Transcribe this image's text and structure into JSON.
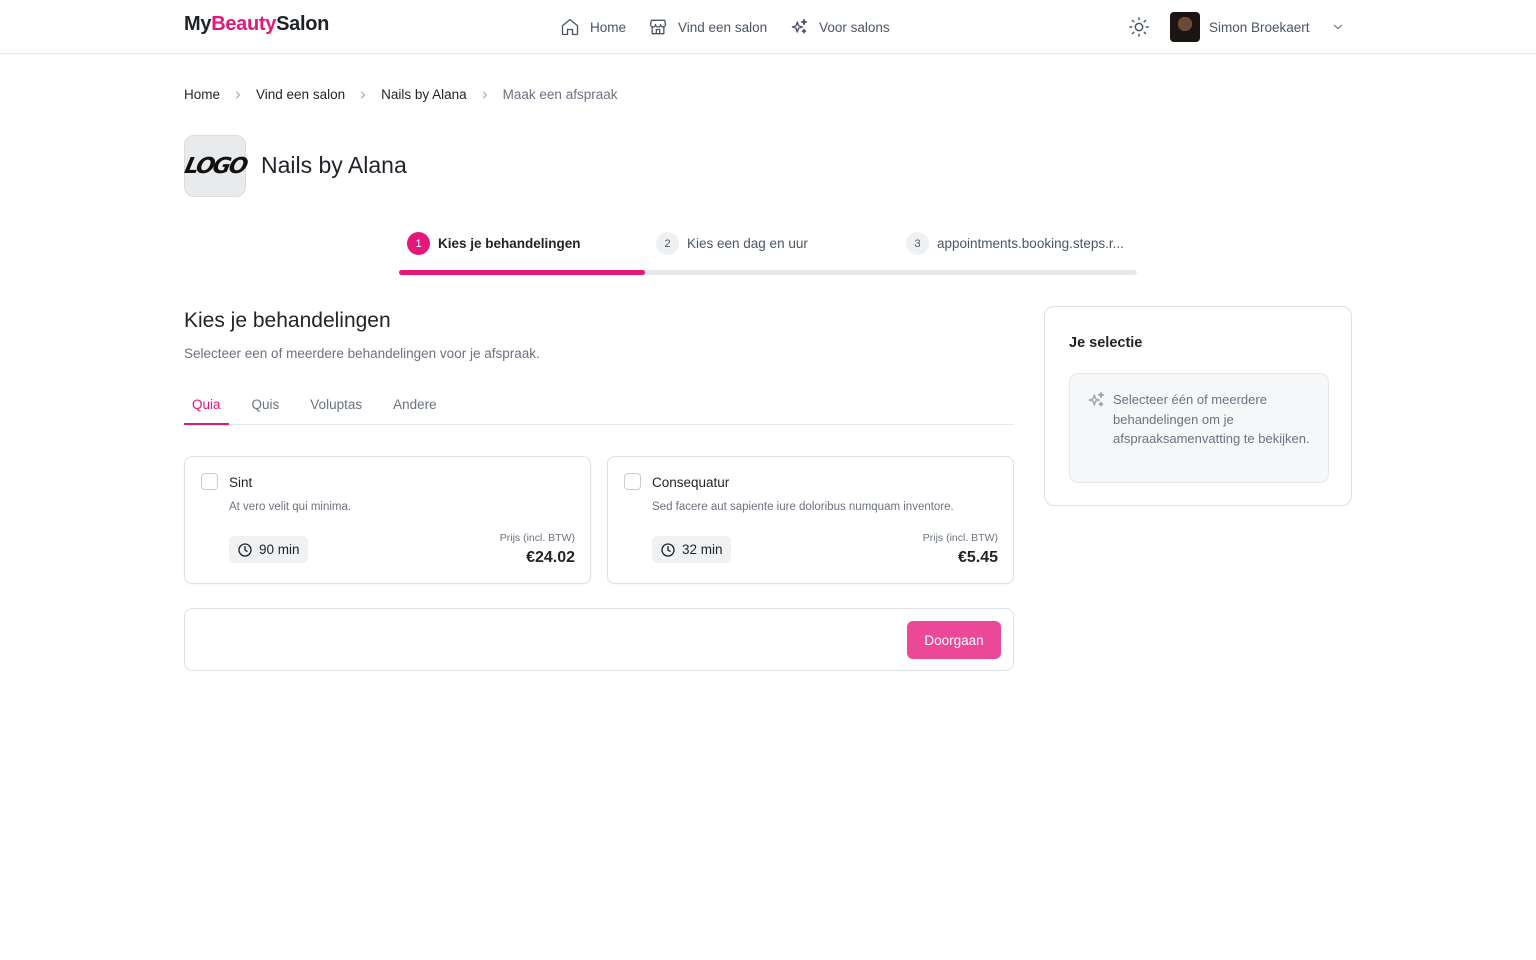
{
  "brand": {
    "prefix": "My",
    "accent": "Beauty",
    "suffix": "Salon"
  },
  "nav": [
    {
      "label": "Home",
      "icon": "home-icon"
    },
    {
      "label": "Vind een salon",
      "icon": "store-icon"
    },
    {
      "label": "Voor salons",
      "icon": "sparkles-icon"
    }
  ],
  "user": {
    "name": "Simon Broekaert"
  },
  "breadcrumb": [
    "Home",
    "Vind een salon",
    "Nails by Alana",
    "Maak een afspraak"
  ],
  "salon": {
    "logo_text": "LOGO",
    "name": "Nails by Alana"
  },
  "steps": {
    "items": [
      {
        "num": "1",
        "label": "Kies je behandelingen"
      },
      {
        "num": "2",
        "label": "Kies een dag en uur"
      },
      {
        "num": "3",
        "label": "appointments.booking.steps.r..."
      }
    ],
    "current": 1,
    "progress": 0.333
  },
  "section": {
    "title": "Kies je behandelingen",
    "subtitle": "Selecteer een of meerdere behandelingen voor je afspraak."
  },
  "tabs": [
    "Quia",
    "Quis",
    "Voluptas",
    "Andere"
  ],
  "treatments": [
    {
      "name": "Sint",
      "description": "At vero velit qui minima.",
      "duration": "90 min",
      "price_label": "Prijs (incl. BTW)",
      "price": "€24.02"
    },
    {
      "name": "Consequatur",
      "description": "Sed facere aut sapiente iure doloribus numquam inventore.",
      "duration": "32 min",
      "price_label": "Prijs (incl. BTW)",
      "price": "€5.45"
    }
  ],
  "actions": {
    "continue": "Doorgaan"
  },
  "selection": {
    "title": "Je selectie",
    "empty": "Selecteer één of meerdere behandelingen om je afspraaksamenvatting te bekijken."
  },
  "colors": {
    "accent": "#e5177a",
    "button": "#ec4899"
  }
}
